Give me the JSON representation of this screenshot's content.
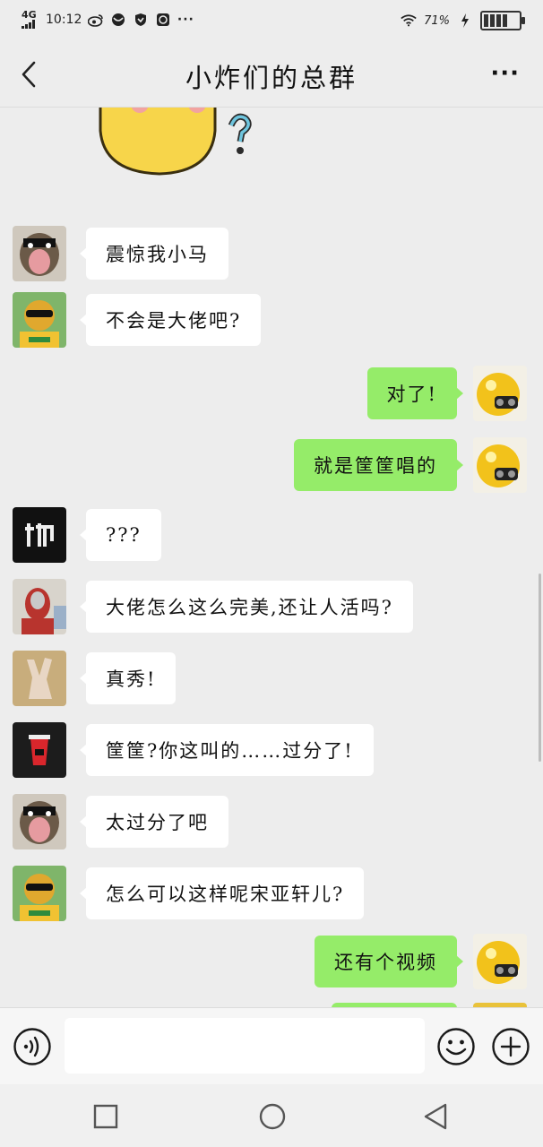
{
  "status_bar": {
    "network": "4G",
    "time": "10:12",
    "battery": "71%",
    "icons": [
      "weibo-icon",
      "app-icon",
      "vpn-icon",
      "qq-icon",
      "more-notifications-icon",
      "wifi-icon",
      "charging-icon",
      "battery-icon"
    ]
  },
  "header": {
    "back_icon": "chevron-left-icon",
    "title": "小炸们的总群",
    "more_label": "···"
  },
  "messages": [
    {
      "side": "left",
      "avatar": "dog-avatar",
      "text": "震惊我小马"
    },
    {
      "side": "left",
      "avatar": "sunglasses-avatar",
      "text": "不会是大佬吧?"
    },
    {
      "side": "right",
      "avatar": "yellow-chick-avatar",
      "text": "对了!"
    },
    {
      "side": "right",
      "avatar": "yellow-chick-avatar",
      "text": "就是筐筐唱的"
    },
    {
      "side": "left",
      "avatar": "shuai-avatar",
      "text": "???"
    },
    {
      "side": "left",
      "avatar": "ultraman-avatar",
      "text": "大佬怎么这么完美,还让人活吗?"
    },
    {
      "side": "left",
      "avatar": "hand-avatar",
      "text": "真秀!"
    },
    {
      "side": "left",
      "avatar": "cup-avatar",
      "text": "筐筐?你这叫的……过分了!"
    },
    {
      "side": "left",
      "avatar": "dog-avatar",
      "text": "太过分了吧"
    },
    {
      "side": "left",
      "avatar": "sunglasses-avatar",
      "text": "怎么可以这样呢宋亚轩儿?"
    },
    {
      "side": "right",
      "avatar": "yellow-chick-avatar",
      "text": "还有个视频"
    }
  ],
  "input_bar": {
    "voice_icon": "voice-icon",
    "input_value": "",
    "emoji_icon": "emoji-icon",
    "plus_icon": "plus-icon"
  },
  "nav": {
    "recent_icon": "square-icon",
    "home_icon": "circle-icon",
    "back_icon": "triangle-back-icon"
  },
  "colors": {
    "background": "#ededed",
    "bubble_self": "#95ec69",
    "bubble_other": "#ffffff"
  }
}
